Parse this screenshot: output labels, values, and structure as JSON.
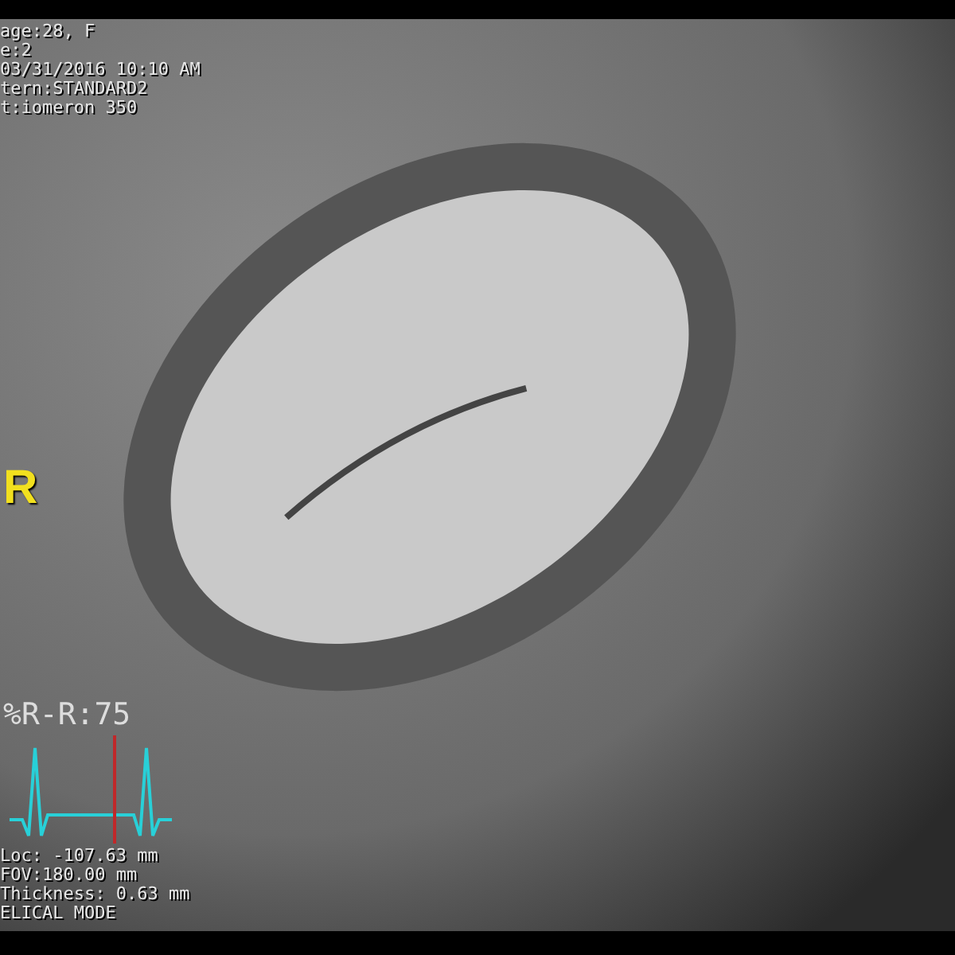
{
  "top_info": [
    "age:28, F",
    "e:2",
    "03/31/2016 10:10 AM",
    "tern:STANDARD2",
    "t:iomeron 350"
  ],
  "orientation_marker": "R",
  "gating": {
    "label": "%R-R:75"
  },
  "bottom_info": [
    "Loc: -107.63 mm",
    "FOV:180.00 mm",
    "Thickness: 0.63 mm",
    "ELICAL MODE"
  ]
}
